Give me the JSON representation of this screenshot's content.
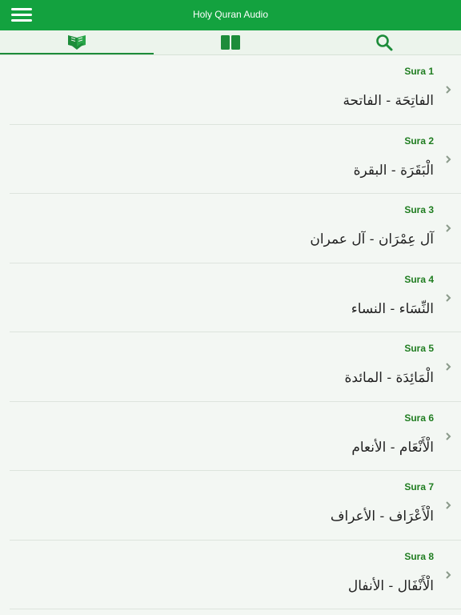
{
  "app": {
    "title": "Holy Quran Audio"
  },
  "colors": {
    "header": "#13a23f",
    "accent": "#1d8c3a",
    "sura_label": "#1f7d20"
  },
  "tabs": [
    {
      "icon": "open-quran-icon",
      "selected": true
    },
    {
      "icon": "book-icon",
      "selected": false
    },
    {
      "icon": "search-icon",
      "selected": false
    }
  ],
  "suras": [
    {
      "label": "Sura 1",
      "name": "الفاتِحَة - الفاتحة"
    },
    {
      "label": "Sura 2",
      "name": "الْبَقَرَة - البقرة"
    },
    {
      "label": "Sura 3",
      "name": "آل عِمْرَان - آل عمران"
    },
    {
      "label": "Sura 4",
      "name": "النِّسَاء - النساء"
    },
    {
      "label": "Sura 5",
      "name": "الْمَائِدَة - المائدة"
    },
    {
      "label": "Sura 6",
      "name": "الْأَنْعَام - الأنعام"
    },
    {
      "label": "Sura 7",
      "name": "الْأَعْرَاف - الأعراف"
    },
    {
      "label": "Sura 8",
      "name": "الْأَنْفَال - الأنفال"
    }
  ]
}
